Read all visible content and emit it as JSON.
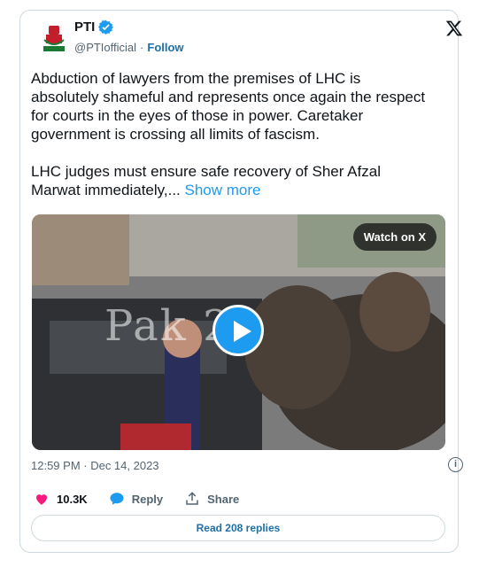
{
  "author": {
    "name": "PTI",
    "handle": "@PTIofficial",
    "follow_label": "Follow",
    "separator": "·"
  },
  "tweet": {
    "paragraph1": "Abduction of lawyers from the premises of LHC is absolutely shameful and represents once again the respect for courts in the eyes of those in power. Caretaker government is crossing all limits of fascism.",
    "paragraph2": "LHC judges must ensure safe recovery of Sher Afzal Marwat immediately,...",
    "show_more": "Show more"
  },
  "media": {
    "watch_label": "Watch on X",
    "watermark": "Pak  24"
  },
  "timestamp": "12:59 PM · Dec 14, 2023",
  "actions": {
    "likes": "10.3K",
    "reply": "Reply",
    "share": "Share"
  },
  "read_replies": "Read 208 replies",
  "colors": {
    "accent": "#1d9bf0",
    "like": "#f91880",
    "text": "#0f1419",
    "muted": "#536471"
  },
  "icons": [
    "verified-badge-icon",
    "x-logo-icon",
    "play-icon",
    "info-icon",
    "heart-icon",
    "reply-bubble-icon",
    "share-icon"
  ]
}
